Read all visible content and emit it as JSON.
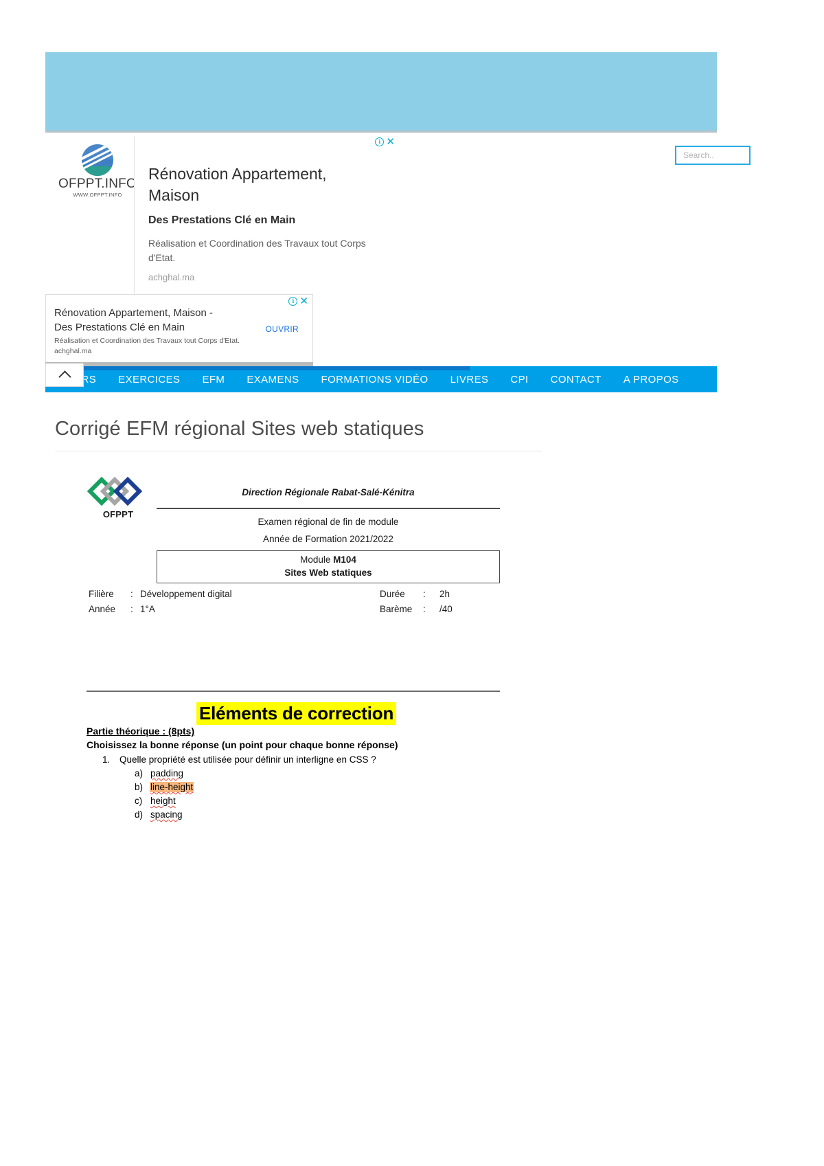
{
  "site": {
    "brand_name": "OFPPT.INFO",
    "brand_sub": "WWW.OFPPT.INFO",
    "search_placeholder": "Search..",
    "search_value": ""
  },
  "nav": {
    "items": [
      {
        "label": "COURS"
      },
      {
        "label": "EXERCICES"
      },
      {
        "label": "EFM"
      },
      {
        "label": "EXAMENS"
      },
      {
        "label": "FORMATIONS VIDÉO"
      },
      {
        "label": "LIVRES"
      },
      {
        "label": "CPI"
      },
      {
        "label": "CONTACT"
      },
      {
        "label": "A PROPOS"
      }
    ],
    "accent_color": "#00a0e9"
  },
  "ads": {
    "main": {
      "title": "Rénovation Appartement, Maison",
      "subtitle": "Des Prestations Clé en Main",
      "body": "Réalisation et Coordination des Travaux tout Corps d'Etat.",
      "url": "achghal.ma",
      "info_icon": "info-icon",
      "close_icon": "close-icon"
    },
    "anchor": {
      "title": "Rénovation Appartement, Maison - Des Prestations Clé en Main",
      "body": "Réalisation et Coordination des Travaux tout Corps d'Etat. achghal.ma",
      "cta": "OUVRIR",
      "cta_color": "#1a73e8"
    }
  },
  "page": {
    "title": "Corrigé EFM régional Sites web statiques"
  },
  "document": {
    "logo_word": "OFPPT",
    "direction": "Direction Régionale Rabat-Salé-Kénitra",
    "exam_line": "Examen régional de fin de module",
    "year_line": "Année de Formation 2021/2022",
    "module_label": "Module ",
    "module_code": "M104",
    "module_name": "Sites Web statiques",
    "meta": {
      "filiere_label": "Filière",
      "filiere_value": "Développement digital",
      "annee_label": "Année",
      "annee_value": "1°A",
      "duree_label": "Durée",
      "duree_value": "2h",
      "bareme_label": "Barème",
      "bareme_value": "/40",
      "colon": ":"
    },
    "correction_title": "Eléments de correction",
    "correction_highlight": "#ffff00",
    "part_title": "Partie théorique : (8pts)",
    "instruction": "Choisissez la bonne réponse (un point pour chaque bonne réponse)",
    "question_number": "1.",
    "question_text": "Quelle propriété est utilisée pour définir un interligne en CSS ?",
    "options": [
      {
        "label": "a)",
        "value": "padding",
        "highlighted": false
      },
      {
        "label": "b)",
        "value": "line-height",
        "highlighted": true
      },
      {
        "label": "c)",
        "value": "height",
        "highlighted": false
      },
      {
        "label": "d)",
        "value": "spacing",
        "highlighted": false
      }
    ],
    "answer_highlight_color": "#f7b77e"
  }
}
